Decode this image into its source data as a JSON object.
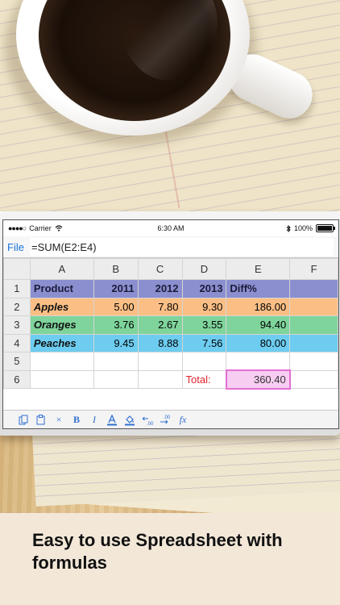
{
  "status_bar": {
    "carrier": "Carrier",
    "time": "6:30 AM",
    "battery": "100%"
  },
  "formula_bar": {
    "file_label": "File",
    "formula": "=SUM(E2:E4)"
  },
  "grid": {
    "column_headers": [
      "A",
      "B",
      "C",
      "D",
      "E",
      "F"
    ],
    "row_headers": [
      "1",
      "2",
      "3",
      "4",
      "5",
      "6"
    ],
    "rows": [
      [
        "Product",
        "2011",
        "2012",
        "2013",
        "Diff%",
        ""
      ],
      [
        "Apples",
        "5.00",
        "7.80",
        "9.30",
        "186.00",
        ""
      ],
      [
        "Oranges",
        "3.76",
        "2.67",
        "3.55",
        "94.40",
        ""
      ],
      [
        "Peaches",
        "9.45",
        "8.88",
        "7.56",
        "80.00",
        ""
      ],
      [
        "",
        "",
        "",
        "",
        "",
        ""
      ],
      [
        "",
        "",
        "",
        "Total:",
        "360.40",
        ""
      ]
    ],
    "row_colors": [
      "#8b8fcf",
      "#fbbf86",
      "#7fd49b",
      "#6dccf0"
    ]
  },
  "toolbar": {
    "icons": [
      "copy-icon",
      "paste-icon",
      "clear-icon",
      "bold-icon",
      "italic-icon",
      "text-color-icon",
      "fill-color-icon",
      "decrease-decimal-icon",
      "increase-decimal-icon",
      "function-icon"
    ],
    "bold": "B",
    "italic": "I",
    "clear": "×",
    "function": "fx"
  },
  "caption": {
    "text": "Easy to use Spreadsheet with formulas"
  }
}
